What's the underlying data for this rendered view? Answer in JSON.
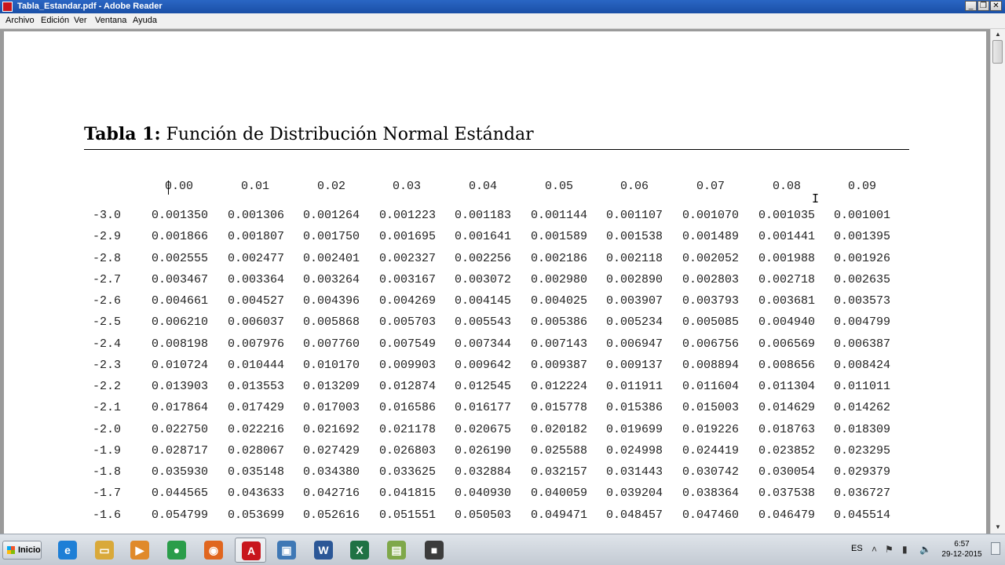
{
  "window": {
    "title": "Tabla_Estandar.pdf - Adobe Reader",
    "controls": {
      "minimize": "_",
      "restore": "❐",
      "close": "✕"
    }
  },
  "menu": [
    "Archivo",
    "Edición",
    "Ver",
    "Ventana",
    "Ayuda"
  ],
  "document": {
    "table_title_bold": "Tabla 1:",
    "table_title_rest": " Función de Distribución Normal Estándar",
    "columns": [
      "0.00",
      "0.01",
      "0.02",
      "0.03",
      "0.04",
      "0.05",
      "0.06",
      "0.07",
      "0.08",
      "0.09"
    ],
    "rows": [
      {
        "z": "-3.0",
        "values": [
          "0.001350",
          "0.001306",
          "0.001264",
          "0.001223",
          "0.001183",
          "0.001144",
          "0.001107",
          "0.001070",
          "0.001035",
          "0.001001"
        ]
      },
      {
        "z": "-2.9",
        "values": [
          "0.001866",
          "0.001807",
          "0.001750",
          "0.001695",
          "0.001641",
          "0.001589",
          "0.001538",
          "0.001489",
          "0.001441",
          "0.001395"
        ]
      },
      {
        "z": "-2.8",
        "values": [
          "0.002555",
          "0.002477",
          "0.002401",
          "0.002327",
          "0.002256",
          "0.002186",
          "0.002118",
          "0.002052",
          "0.001988",
          "0.001926"
        ]
      },
      {
        "z": "-2.7",
        "values": [
          "0.003467",
          "0.003364",
          "0.003264",
          "0.003167",
          "0.003072",
          "0.002980",
          "0.002890",
          "0.002803",
          "0.002718",
          "0.002635"
        ]
      },
      {
        "z": "-2.6",
        "values": [
          "0.004661",
          "0.004527",
          "0.004396",
          "0.004269",
          "0.004145",
          "0.004025",
          "0.003907",
          "0.003793",
          "0.003681",
          "0.003573"
        ]
      },
      {
        "z": "-2.5",
        "values": [
          "0.006210",
          "0.006037",
          "0.005868",
          "0.005703",
          "0.005543",
          "0.005386",
          "0.005234",
          "0.005085",
          "0.004940",
          "0.004799"
        ]
      },
      {
        "z": "-2.4",
        "values": [
          "0.008198",
          "0.007976",
          "0.007760",
          "0.007549",
          "0.007344",
          "0.007143",
          "0.006947",
          "0.006756",
          "0.006569",
          "0.006387"
        ]
      },
      {
        "z": "-2.3",
        "values": [
          "0.010724",
          "0.010444",
          "0.010170",
          "0.009903",
          "0.009642",
          "0.009387",
          "0.009137",
          "0.008894",
          "0.008656",
          "0.008424"
        ]
      },
      {
        "z": "-2.2",
        "values": [
          "0.013903",
          "0.013553",
          "0.013209",
          "0.012874",
          "0.012545",
          "0.012224",
          "0.011911",
          "0.011604",
          "0.011304",
          "0.011011"
        ]
      },
      {
        "z": "-2.1",
        "values": [
          "0.017864",
          "0.017429",
          "0.017003",
          "0.016586",
          "0.016177",
          "0.015778",
          "0.015386",
          "0.015003",
          "0.014629",
          "0.014262"
        ]
      },
      {
        "z": "-2.0",
        "values": [
          "0.022750",
          "0.022216",
          "0.021692",
          "0.021178",
          "0.020675",
          "0.020182",
          "0.019699",
          "0.019226",
          "0.018763",
          "0.018309"
        ]
      },
      {
        "z": "-1.9",
        "values": [
          "0.028717",
          "0.028067",
          "0.027429",
          "0.026803",
          "0.026190",
          "0.025588",
          "0.024998",
          "0.024419",
          "0.023852",
          "0.023295"
        ]
      },
      {
        "z": "-1.8",
        "values": [
          "0.035930",
          "0.035148",
          "0.034380",
          "0.033625",
          "0.032884",
          "0.032157",
          "0.031443",
          "0.030742",
          "0.030054",
          "0.029379"
        ]
      },
      {
        "z": "-1.7",
        "values": [
          "0.044565",
          "0.043633",
          "0.042716",
          "0.041815",
          "0.040930",
          "0.040059",
          "0.039204",
          "0.038364",
          "0.037538",
          "0.036727"
        ]
      },
      {
        "z": "-1.6",
        "values": [
          "0.054799",
          "0.053699",
          "0.052616",
          "0.051551",
          "0.050503",
          "0.049471",
          "0.048457",
          "0.047460",
          "0.046479",
          "0.045514"
        ]
      }
    ]
  },
  "taskbar": {
    "start_label": "Inicio",
    "apps": [
      {
        "name": "internet-explorer",
        "glyph": "e",
        "color": "#1e7fd6"
      },
      {
        "name": "file-explorer",
        "glyph": "▭",
        "color": "#d9a93a"
      },
      {
        "name": "media-player",
        "glyph": "▶",
        "color": "#e08a2a"
      },
      {
        "name": "chrome",
        "glyph": "●",
        "color": "#2a9d4a"
      },
      {
        "name": "firefox",
        "glyph": "◉",
        "color": "#e0661f"
      },
      {
        "name": "adobe-reader",
        "glyph": "A",
        "color": "#c8161d"
      },
      {
        "name": "picture-viewer",
        "glyph": "▣",
        "color": "#3f78b5"
      },
      {
        "name": "word",
        "glyph": "W",
        "color": "#2b5797"
      },
      {
        "name": "excel",
        "glyph": "X",
        "color": "#1f7244"
      },
      {
        "name": "publisher",
        "glyph": "▤",
        "color": "#7fa84a"
      },
      {
        "name": "camera-app",
        "glyph": "■",
        "color": "#3c3c3c"
      }
    ],
    "active_app": "adobe-reader",
    "language": "ES",
    "time": "6:57",
    "date": "29-12-2015"
  }
}
